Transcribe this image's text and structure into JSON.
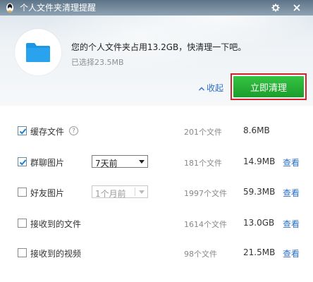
{
  "window": {
    "title": "个人文件夹清理提醒"
  },
  "header": {
    "main_message": "您的个人文件夹占用13.2GB，快清理一下吧。",
    "selected_message": "已选择23.5MB",
    "collapse_label": "收起",
    "clean_button": "立即清理"
  },
  "colors": {
    "accent_blue": "#2a6fc8",
    "clean_green": "#23a934",
    "highlight_red": "#d6232a",
    "folder_blue": "#1e96e6"
  },
  "items": [
    {
      "label": "缓存文件",
      "checked": true,
      "count": "201个文件",
      "size": "8.6MB",
      "view": ""
    },
    {
      "label": "群聊图片",
      "checked": true,
      "dropdown": "7天前",
      "count": "181个文件",
      "size": "14.9MB",
      "view": "查看"
    },
    {
      "label": "好友图片",
      "checked": false,
      "dropdown": "1个月前",
      "count": "1997个文件",
      "size": "59.3MB",
      "view": "查看"
    },
    {
      "label": "接收到的文件",
      "checked": false,
      "count": "1614个文件",
      "size": "13.0GB",
      "view": "查看"
    },
    {
      "label": "接收到的视频",
      "checked": false,
      "count": "98个文件",
      "size": "21.5MB",
      "view": "查看"
    }
  ],
  "help_glyph": "?"
}
